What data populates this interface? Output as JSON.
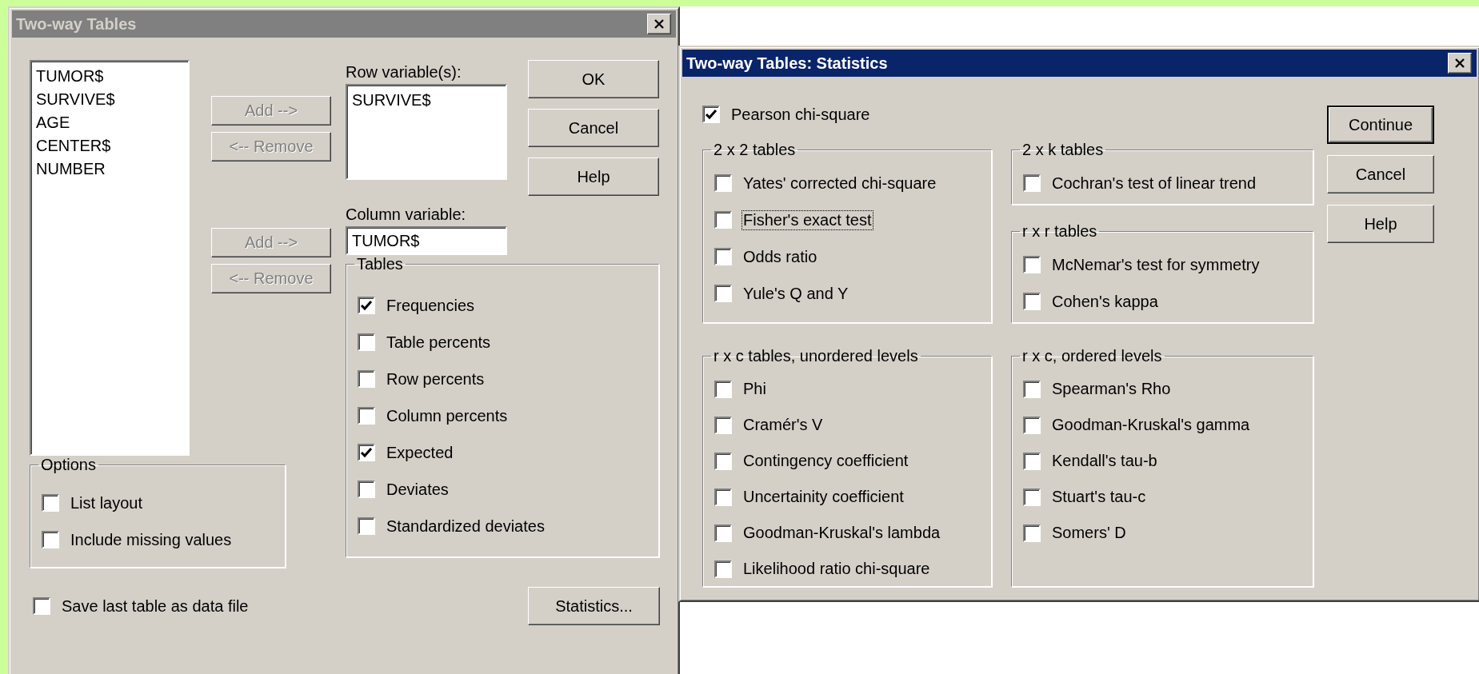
{
  "main_dialog": {
    "title": "Two-way Tables",
    "active": false,
    "variables": [
      "TUMOR$",
      "SURVIVE$",
      "AGE",
      "CENTER$",
      "NUMBER"
    ],
    "row_variable": {
      "label": "Row variable(s):",
      "items": [
        "SURVIVE$"
      ],
      "add_button": {
        "label": "Add -->",
        "disabled": true
      },
      "remove_button": {
        "label": "<-- Remove",
        "disabled": true
      }
    },
    "column_variable": {
      "label": "Column variable:",
      "value": "TUMOR$",
      "add_button": {
        "label": "Add -->",
        "disabled": true
      },
      "remove_button": {
        "label": "<-- Remove",
        "disabled": true
      }
    },
    "buttons": [
      {
        "label": "OK",
        "disabled": false
      },
      {
        "label": "Cancel",
        "disabled": false
      },
      {
        "label": "Help",
        "disabled": false
      }
    ],
    "options": {
      "title": "Options",
      "items": [
        {
          "label": "List layout",
          "checked": false
        },
        {
          "label": "Include missing values",
          "checked": false
        }
      ]
    },
    "tables": {
      "title": "Tables",
      "items": [
        {
          "label": "Frequencies",
          "checked": true
        },
        {
          "label": "Table percents",
          "checked": false
        },
        {
          "label": "Row percents",
          "checked": false
        },
        {
          "label": "Column percents",
          "checked": false
        },
        {
          "label": "Expected",
          "checked": true
        },
        {
          "label": "Deviates",
          "checked": false
        },
        {
          "label": "Standardized deviates",
          "checked": false
        }
      ]
    },
    "save_option": {
      "label": "Save last table as data file",
      "checked": false
    },
    "statistics_button": {
      "label": "Statistics...",
      "disabled": false
    }
  },
  "statistics_dialog": {
    "title": "Two-way Tables: Statistics",
    "active": true,
    "pearson": {
      "label": "Pearson chi-square",
      "checked": true
    },
    "buttons": [
      {
        "label": "Continue",
        "default": true
      },
      {
        "label": "Cancel",
        "default": false
      },
      {
        "label": "Help",
        "default": false
      }
    ],
    "columns": [
      [
        {
          "title": "2 x 2 tables",
          "items": [
            {
              "label": "Yates' corrected chi-square",
              "checked": false,
              "focused": false
            },
            {
              "label": "Fisher's exact test",
              "checked": false,
              "focused": true
            },
            {
              "label": "Odds ratio",
              "checked": false,
              "focused": false
            },
            {
              "label": "Yule's Q and Y",
              "checked": false,
              "focused": false
            }
          ]
        },
        {
          "title": "r x c tables, unordered levels",
          "items": [
            {
              "label": "Phi",
              "checked": false,
              "focused": false
            },
            {
              "label": "Cramér's V",
              "checked": false,
              "focused": false
            },
            {
              "label": "Contingency coefficient",
              "checked": false,
              "focused": false
            },
            {
              "label": "Uncertainity coefficient",
              "checked": false,
              "focused": false
            },
            {
              "label": "Goodman-Kruskal's lambda",
              "checked": false,
              "focused": false
            },
            {
              "label": "Likelihood ratio chi-square",
              "checked": false,
              "focused": false
            }
          ]
        }
      ],
      [
        {
          "title": "2 x k tables",
          "items": [
            {
              "label": "Cochran's test of linear trend",
              "checked": false,
              "focused": false
            }
          ]
        },
        {
          "title": "r x r tables",
          "items": [
            {
              "label": "McNemar's test for symmetry",
              "checked": false,
              "focused": false
            },
            {
              "label": "Cohen's kappa",
              "checked": false,
              "focused": false
            }
          ]
        },
        {
          "title": "r x c, ordered levels",
          "items": [
            {
              "label": "Spearman's Rho",
              "checked": false,
              "focused": false
            },
            {
              "label": "Goodman-Kruskal's gamma",
              "checked": false,
              "focused": false
            },
            {
              "label": "Kendall's tau-b",
              "checked": false,
              "focused": false
            },
            {
              "label": "Stuart's tau-c",
              "checked": false,
              "focused": false
            },
            {
              "label": "Somers' D",
              "checked": false,
              "focused": false
            }
          ]
        }
      ]
    ]
  }
}
